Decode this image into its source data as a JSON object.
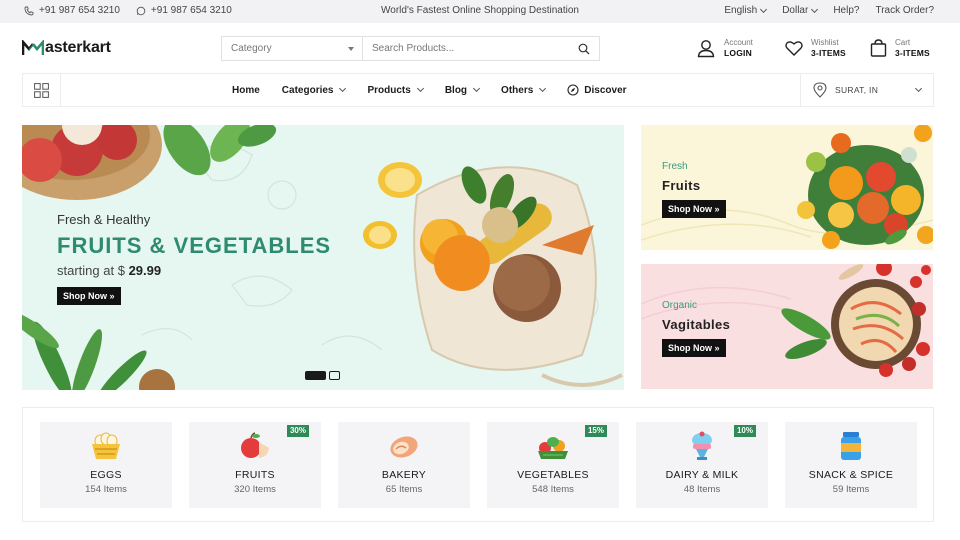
{
  "topbar": {
    "phone1": "+91 987 654 3210",
    "phone2": "+91 987 654 3210",
    "tagline": "World's Fastest Online Shopping Destination",
    "language": "English",
    "currency": "Dollar",
    "help": "Help?",
    "track": "Track Order?"
  },
  "header": {
    "logo_text": "asterkart",
    "search": {
      "category_placeholder": "Category",
      "placeholder": "Search Products..."
    },
    "account": {
      "label": "Account",
      "value": "LOGIN"
    },
    "wishlist": {
      "label": "Wishlist",
      "value": "3-ITEMS"
    },
    "cart": {
      "label": "Cart",
      "value": "3-ITEMS"
    }
  },
  "nav": {
    "items": [
      {
        "label": "Home"
      },
      {
        "label": "Categories"
      },
      {
        "label": "Products"
      },
      {
        "label": "Blog"
      },
      {
        "label": "Others"
      },
      {
        "label": "Discover"
      }
    ],
    "location": "SURAT, IN"
  },
  "hero": {
    "subtitle": "Fresh & Healthy",
    "title": "FRUITS & VEGETABLES",
    "price_prefix": "starting at $",
    "price": "29.99",
    "button": "Shop Now »"
  },
  "promos": [
    {
      "subtitle": "Fresh",
      "title": "Fruits",
      "button": "Shop Now »"
    },
    {
      "subtitle": "Organic",
      "title": "Vagitables",
      "button": "Shop Now »"
    }
  ],
  "categories": [
    {
      "name": "EGGS",
      "count": "154 Items",
      "badge": "",
      "icon": "eggs-basket-icon"
    },
    {
      "name": "FRUITS",
      "count": "320 Items",
      "badge": "30%",
      "icon": "apple-icon"
    },
    {
      "name": "BAKERY",
      "count": "65 Items",
      "badge": "",
      "icon": "bread-icon"
    },
    {
      "name": "VEGETABLES",
      "count": "548 Items",
      "badge": "15%",
      "icon": "vegetables-icon"
    },
    {
      "name": "DAIRY & MILK",
      "count": "48 Items",
      "badge": "10%",
      "icon": "ice-cream-icon"
    },
    {
      "name": "SNACK & SPICE",
      "count": "59 Items",
      "badge": "",
      "icon": "jar-icon"
    }
  ],
  "colors": {
    "accent": "#2e8b70",
    "hero_bg": "#e6f6f1",
    "promo1_bg": "#fbf5d9",
    "promo2_bg": "#f9dfe0",
    "badge": "#2e8b57"
  }
}
